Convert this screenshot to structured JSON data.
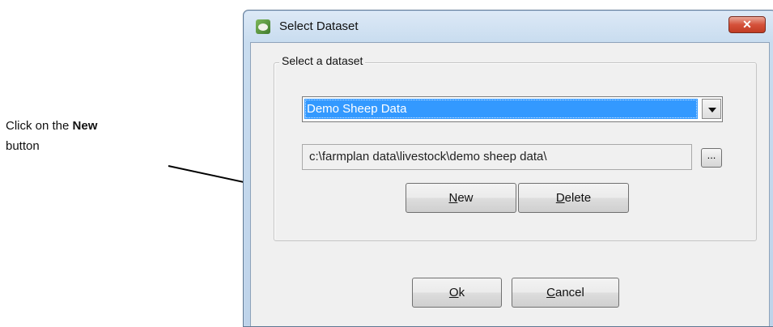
{
  "annotation": {
    "prefix": "Click on the ",
    "bold": "New",
    "line2": "button"
  },
  "window": {
    "title": "Select Dataset",
    "close_label": "✕",
    "icon": "sheep-app-icon"
  },
  "group": {
    "label": "Select a dataset"
  },
  "dataset_combo": {
    "selected": "Demo Sheep Data"
  },
  "path_field": {
    "value": "c:\\farmplan data\\livestock\\demo sheep data\\"
  },
  "browse_button": {
    "label": "..."
  },
  "buttons": {
    "new": {
      "accel": "N",
      "rest": "ew"
    },
    "delete": {
      "accel": "D",
      "rest": "elete"
    },
    "ok": {
      "accel": "O",
      "rest": "k"
    },
    "cancel": {
      "accel": "C",
      "rest": "ancel"
    }
  },
  "colors": {
    "selection": "#3399ff",
    "close_button": "#d5513a",
    "title_bar": "#c8dcef"
  }
}
